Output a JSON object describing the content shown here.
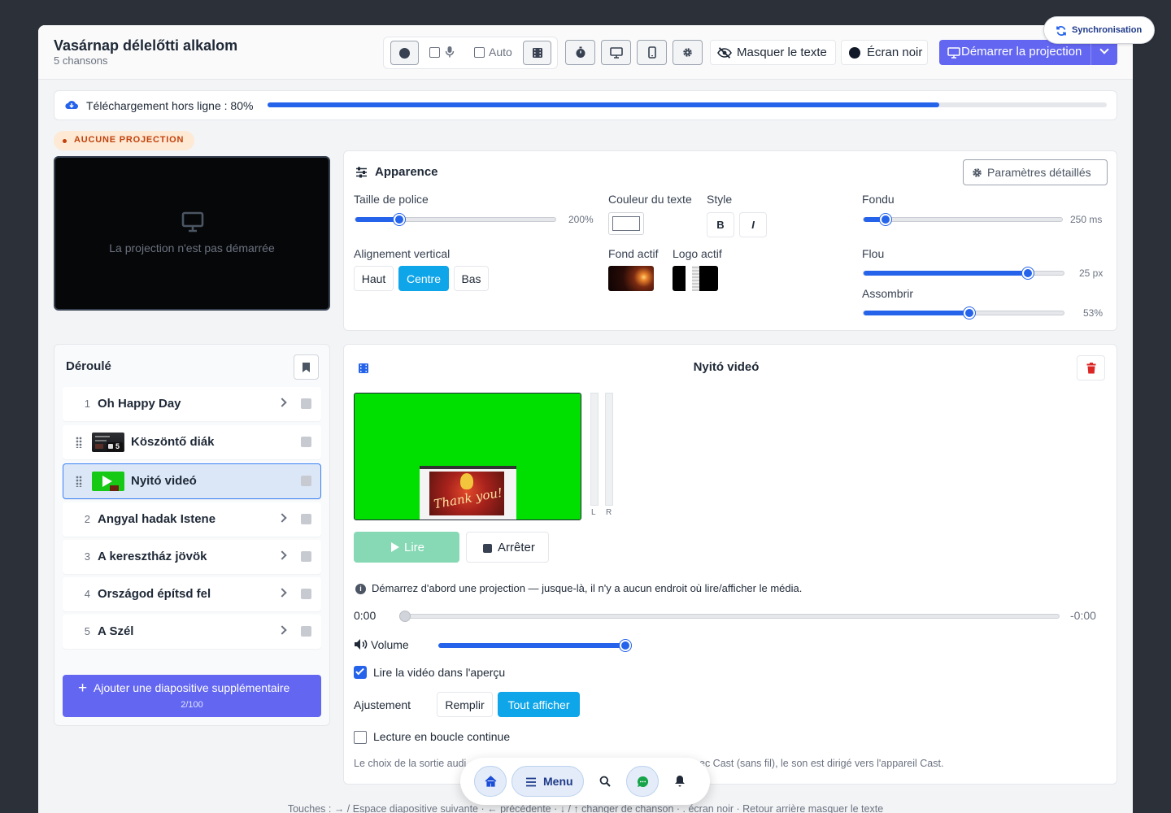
{
  "header": {
    "title": "Vasárnap délelőtti alkalom",
    "subtitle": "5 chansons",
    "auto_label": "Auto",
    "hide_text_label": "Masquer le texte",
    "black_screen_label": "Écran noir",
    "start_projection_label": "Démarrer la projection"
  },
  "sync_badge": {
    "label": "Synchronisation"
  },
  "offline": {
    "label": "Téléchargement hors ligne : 80%",
    "progress": 0.8
  },
  "projection_status": {
    "badge": "AUCUNE PROJECTION",
    "message": "La projection n'est pas démarrée"
  },
  "appearance": {
    "title": "Apparence",
    "detailed_settings_label": "Paramètres détaillés",
    "font_size": {
      "label": "Taille de police",
      "value_text": "200%",
      "value": 0.22
    },
    "text_color": {
      "label": "Couleur du texte",
      "value": "#ffffff"
    },
    "style": {
      "label": "Style",
      "bold": "B",
      "italic": "I"
    },
    "fade": {
      "label": "Fondu",
      "value_text": "250 ms",
      "value": 0.11
    },
    "vertical_align": {
      "label": "Alignement vertical",
      "options": [
        "Haut",
        "Centre",
        "Bas"
      ],
      "selected": "Centre"
    },
    "active_background": {
      "label": "Fond actif"
    },
    "active_logo": {
      "label": "Logo actif"
    },
    "blur": {
      "label": "Flou",
      "value_text": "25 px",
      "value": 0.82
    },
    "darken": {
      "label": "Assombrir",
      "value_text": "53%",
      "value": 0.53
    }
  },
  "rundown": {
    "title": "Déroulé",
    "items": [
      {
        "number": "1",
        "name": "Oh Happy Day",
        "type": "song"
      },
      {
        "number": "",
        "name": "Köszöntő diák",
        "type": "slides",
        "badge": "5"
      },
      {
        "number": "",
        "name": "Nyitó videó",
        "type": "video",
        "selected": true
      },
      {
        "number": "2",
        "name": "Angyal hadak Istene",
        "type": "song"
      },
      {
        "number": "3",
        "name": "A keresztház jövök",
        "type": "song"
      },
      {
        "number": "4",
        "name": "Országod építsd fel",
        "type": "song"
      },
      {
        "number": "5",
        "name": "A Szél",
        "type": "song"
      }
    ],
    "add_slide_label": "Ajouter une diapositive supplémentaire",
    "add_slide_count": "2/100"
  },
  "video": {
    "title": "Nyitó videó",
    "thumbnail_text": "Thank you!",
    "meter_left": "L",
    "meter_right": "R",
    "play_label": "Lire",
    "stop_label": "Arrêter",
    "info": "Démarrez d'abord une projection — jusque-là, il n'y a aucun endroit où lire/afficher le média.",
    "time_current": "0:00",
    "time_remaining": "-0:00",
    "position": 0,
    "volume_label": "Volume",
    "volume": 1.0,
    "preview_checkbox_label": "Lire la vidéo dans l'aperçu",
    "preview_checked": true,
    "fit_label": "Ajustement",
    "fit_options": [
      "Remplir",
      "Tout afficher"
    ],
    "fit_selected": "Tout afficher",
    "loop_label": "Lecture en boucle continue",
    "loop_checked": false,
    "output_note_left": "Le choix de la sortie audi",
    "output_note_right": "ec Cast (sans fil), le son est dirigé vers l'appareil Cast."
  },
  "bottom_nav": {
    "menu_label": "Menu"
  },
  "shortcuts": "Touches : → / Espace diapositive suivante · ← précédente · ↓ / ↑ changer de chanson · . écran noir · Retour arrière masquer le texte",
  "colors": {
    "accent": "#2563eb",
    "primary_purple": "#6366f1",
    "selected_option": "#0ea5e9",
    "play_green": "#86d9b4",
    "video_green": "#00e000",
    "delete_red": "#dc2626"
  }
}
